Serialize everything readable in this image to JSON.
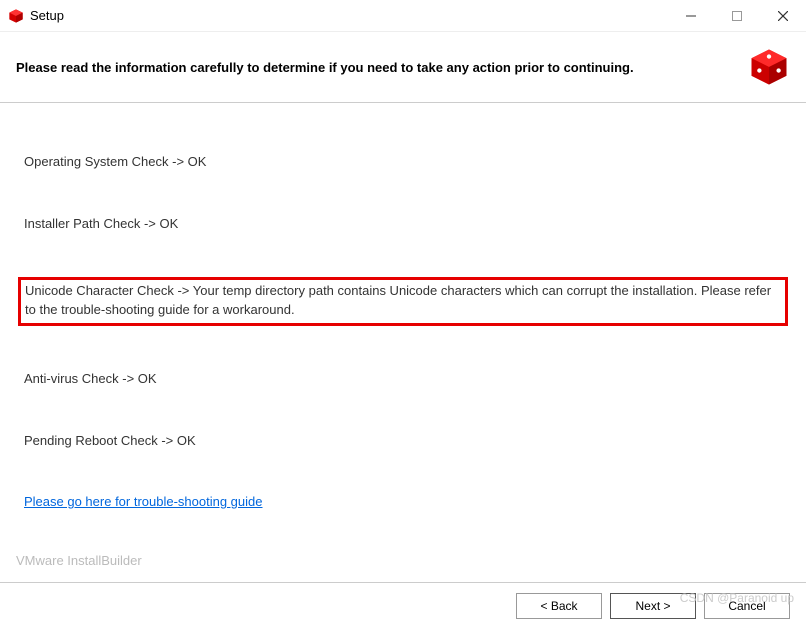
{
  "window": {
    "title": "Setup",
    "headerText": "Please read the information carefully to determine if you need to take any action prior to continuing."
  },
  "checks": {
    "os": "Operating System Check -> OK",
    "installerPath": "Installer Path Check -> OK",
    "unicode": "Unicode Character Check ->  Your temp directory path contains Unicode characters which can corrupt the installation. Please refer to the trouble-shooting guide for a workaround.",
    "antivirus": "Anti-virus Check -> OK",
    "reboot": "Pending Reboot Check -> OK"
  },
  "link": {
    "troubleshoot": "Please go here for trouble-shooting guide"
  },
  "footer": {
    "brand": "VMware InstallBuilder",
    "back": "< Back",
    "next": "Next >",
    "cancel": "Cancel"
  },
  "watermark": "CSDN @Paranoid up",
  "colors": {
    "highlight": "#e60000",
    "link": "#0066dd",
    "brand": "#d40000"
  }
}
